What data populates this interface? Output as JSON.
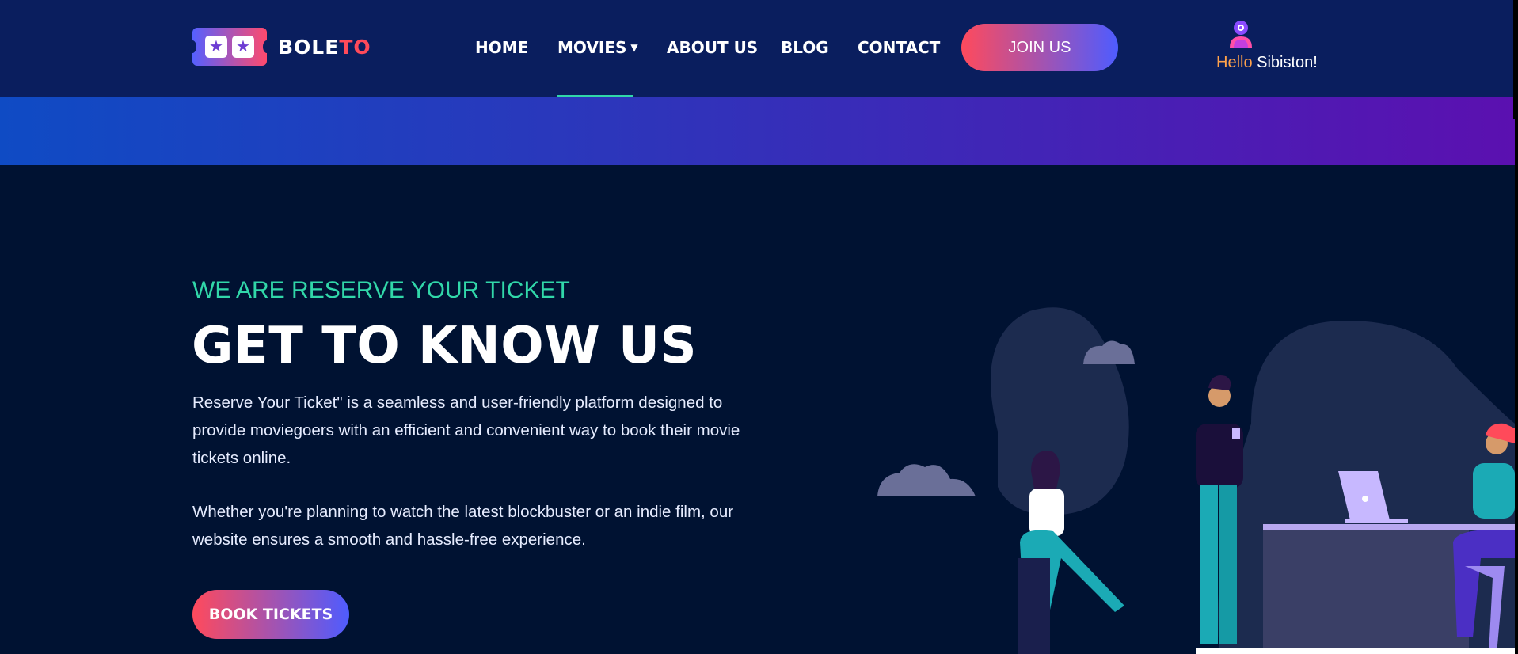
{
  "brand": {
    "logo_text_white": "BOLE",
    "logo_text_red": "TO",
    "logo_icon": "ticket-stars-logo"
  },
  "nav": {
    "items": [
      {
        "label": "HOME"
      },
      {
        "label": "MOVIES",
        "has_dropdown": true,
        "active": true
      },
      {
        "label": "ABOUT US"
      },
      {
        "label": "BLOG"
      },
      {
        "label": "CONTACT"
      }
    ],
    "join_label": "JOIN US"
  },
  "user": {
    "hello": "Hello",
    "name": "Sibiston!",
    "icon": "user-avatar-icon"
  },
  "hero": {
    "subtitle": "WE ARE RESERVE YOUR TICKET",
    "title": "GET TO KNOW US",
    "paragraph_1": "Reserve Your Ticket\" is a seamless and user-friendly platform designed to provide moviegoers with an efficient and convenient way to book their movie tickets online.",
    "paragraph_2": "Whether you're planning to watch the latest blockbuster or an indie film, our website ensures a smooth and hassle-free experience.",
    "cta_label": "BOOK TICKETS"
  },
  "colors": {
    "accent_teal": "#31d7a9",
    "accent_orange": "#ffa24b",
    "brand_red": "#ff4a5a",
    "gradient_start": "#ff4a5c",
    "gradient_end": "#4e5cff",
    "page_bg": "#001232",
    "header_bg": "#0a1e5e"
  }
}
